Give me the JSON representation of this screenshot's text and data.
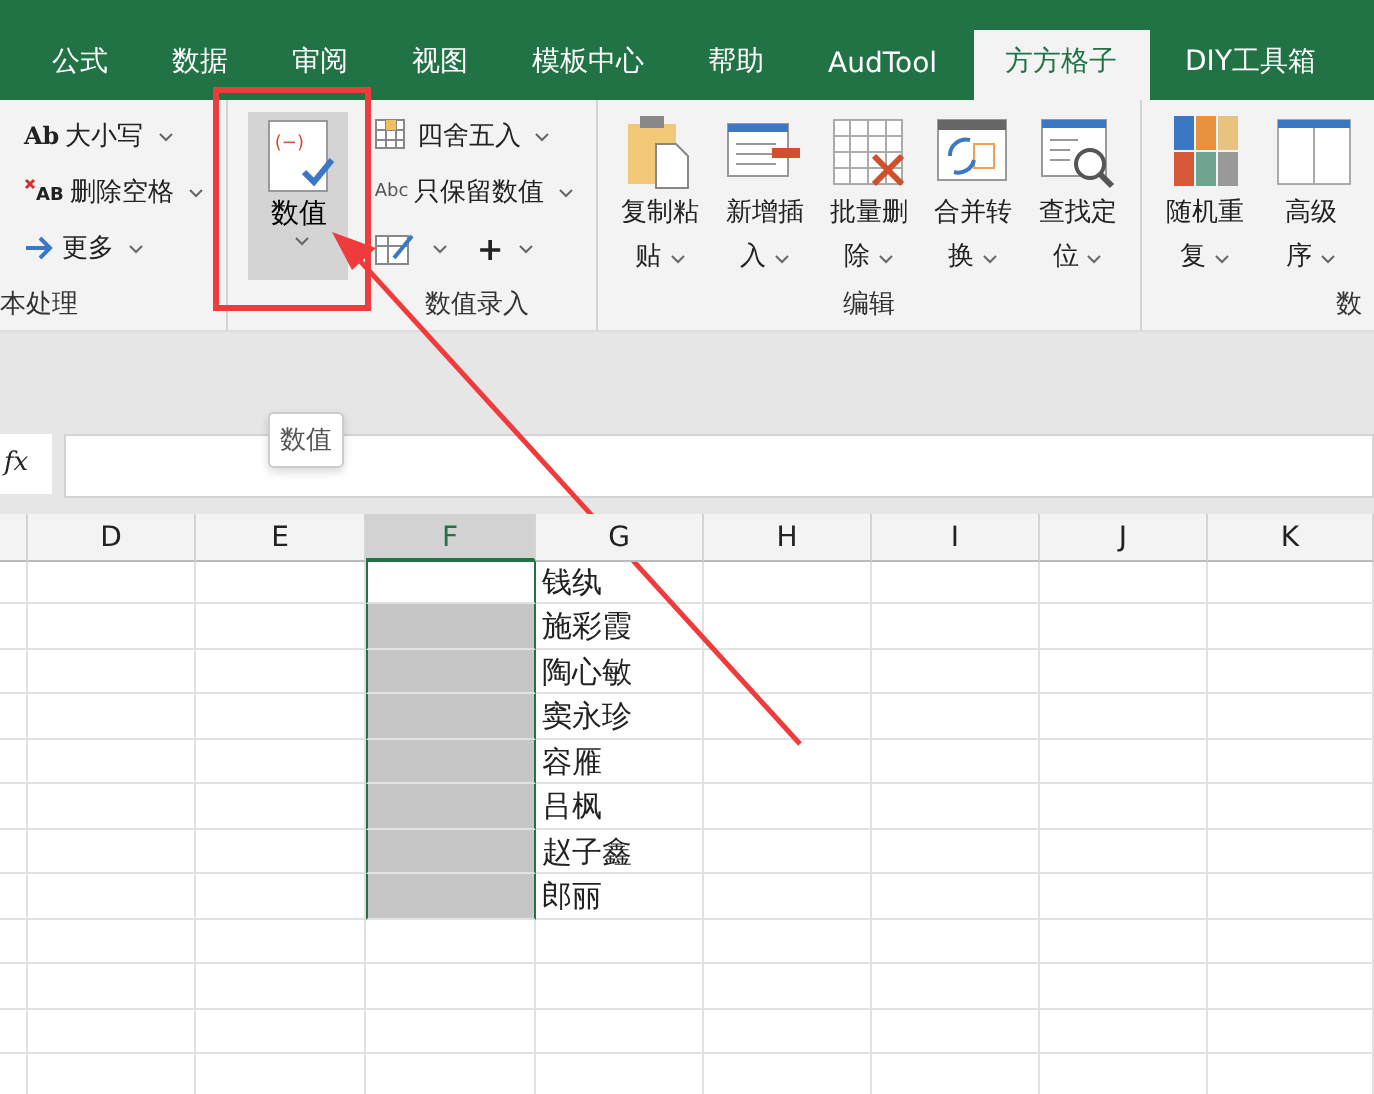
{
  "tabs": [
    {
      "label": "公式",
      "selected": false
    },
    {
      "label": "数据",
      "selected": false
    },
    {
      "label": "审阅",
      "selected": false
    },
    {
      "label": "视图",
      "selected": false
    },
    {
      "label": "模板中心",
      "selected": false
    },
    {
      "label": "帮助",
      "selected": false
    },
    {
      "label": "AudTool",
      "selected": false
    },
    {
      "label": "方方格子",
      "selected": true
    },
    {
      "label": "DIY工具箱",
      "selected": false
    }
  ],
  "ribbon": {
    "groups": [
      {
        "kind": "small",
        "title": "本处理",
        "items": [
          {
            "kind": "case",
            "icon_text": "Ab",
            "label": "大小写"
          },
          {
            "kind": "trim",
            "icon_text": "AB",
            "label": "删除空格"
          },
          {
            "kind": "more",
            "label": "更多"
          }
        ]
      },
      {
        "kind": "numeric",
        "title": "数值录入",
        "big": {
          "label": "数值",
          "icon_text": "(−)",
          "selected": true
        },
        "items": [
          {
            "kind": "round",
            "label": "四舍五入"
          },
          {
            "kind": "keep",
            "icon_text": "Abc",
            "label": "只保留数值"
          }
        ],
        "plus": "+"
      },
      {
        "kind": "large",
        "title": "编辑",
        "items": [
          {
            "kind": "paste",
            "line1": "复制粘",
            "line2": "贴"
          },
          {
            "kind": "insert",
            "line1": "新增插",
            "line2": "入"
          },
          {
            "kind": "delete",
            "line1": "批量删",
            "line2": "除"
          },
          {
            "kind": "merge",
            "line1": "合并转",
            "line2": "换"
          },
          {
            "kind": "find",
            "line1": "查找定",
            "line2": "位"
          }
        ]
      },
      {
        "kind": "large",
        "title": "数",
        "items": [
          {
            "kind": "random",
            "line1": "随机重",
            "line2": "复"
          },
          {
            "kind": "sort",
            "line1": "高级",
            "line2": "序"
          }
        ]
      }
    ]
  },
  "tooltip": "数值",
  "formula_bar": {
    "fx": "fx"
  },
  "sheet": {
    "columns": [
      {
        "label": "D",
        "selected": false
      },
      {
        "label": "E",
        "selected": false
      },
      {
        "label": "F",
        "selected": true
      },
      {
        "label": "G",
        "selected": false
      },
      {
        "label": "H",
        "selected": false
      },
      {
        "label": "I",
        "selected": false
      },
      {
        "label": "J",
        "selected": false
      },
      {
        "label": "K",
        "selected": false
      }
    ],
    "rows": [
      {
        "column_g": "钱纨",
        "selected": true,
        "active": true
      },
      {
        "column_g": "施彩霞",
        "selected": true,
        "active": false
      },
      {
        "column_g": "陶心敏",
        "selected": true,
        "active": false
      },
      {
        "column_g": "窦永珍",
        "selected": true,
        "active": false
      },
      {
        "column_g": "容雁",
        "selected": true,
        "active": false
      },
      {
        "column_g": "吕枫",
        "selected": true,
        "active": false
      },
      {
        "column_g": "赵子鑫",
        "selected": true,
        "active": false
      },
      {
        "column_g": "郎丽",
        "selected": true,
        "active": false
      }
    ]
  }
}
